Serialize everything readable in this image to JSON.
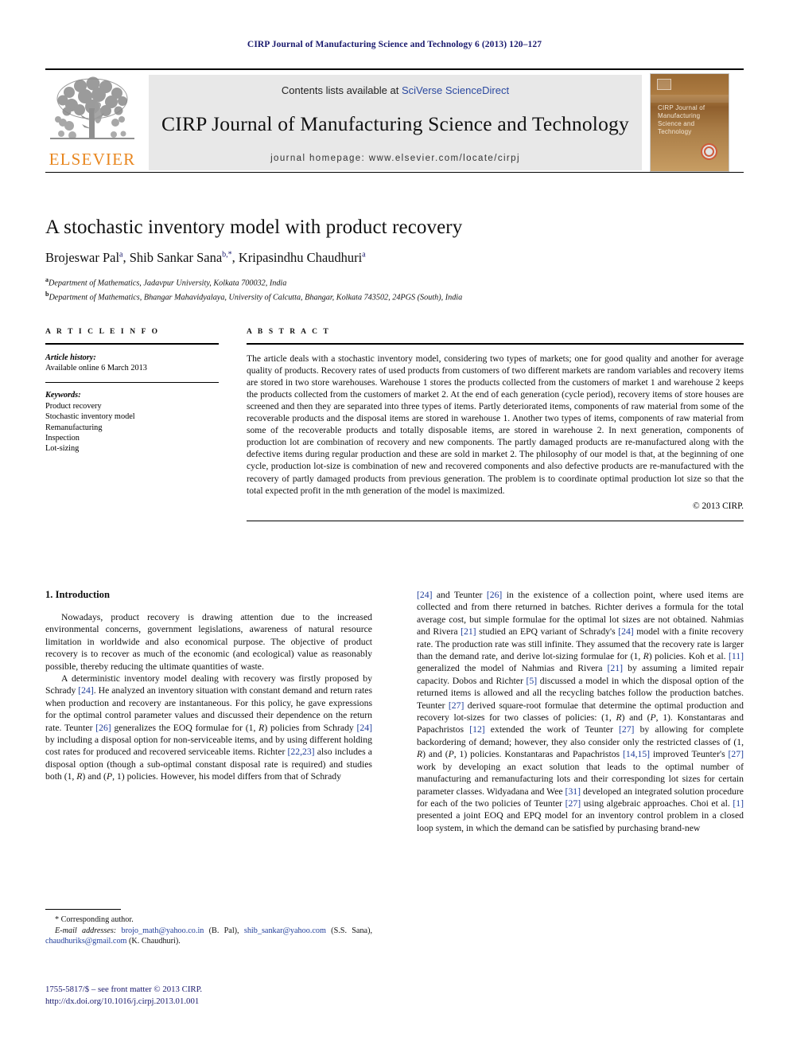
{
  "running_head": "CIRP Journal of Manufacturing Science and Technology 6 (2013) 120–127",
  "masthead": {
    "contents_prefix": "Contents lists available at ",
    "sciencedirect_link": "SciVerse ScienceDirect",
    "journal_title": "CIRP Journal of Manufacturing Science and Technology",
    "homepage_line": "journal homepage: www.elsevier.com/locate/cirpj",
    "publisher_wordmark": "ELSEVIER",
    "publisher_color": "#E8861E",
    "link_color": "#2b49a0",
    "cover": {
      "title_text": "CIRP Journal of Manufacturing Science and Technology",
      "base_color": "#a87b45"
    }
  },
  "article": {
    "title": "A stochastic inventory model with product recovery",
    "authors_html": "Brojeswar Pal<sup>a</sup>, Shib Sankar Sana<sup>b,<span class=\"star\">*</span></sup>, Kripasindhu Chaudhuri<sup>a</sup>",
    "affiliations": [
      {
        "marker": "a",
        "text": "Department of Mathematics, Jadavpur University, Kolkata 700032, India"
      },
      {
        "marker": "b",
        "text": "Department of Mathematics, Bhangar Mahavidyalaya, University of Calcutta, Bhangar, Kolkata 743502, 24PGS (South), India"
      }
    ]
  },
  "article_info": {
    "heading": "A R T I C L E   I N F O",
    "history_label": "Article history:",
    "history_value": "Available online 6 March 2013",
    "keywords_label": "Keywords:",
    "keywords": [
      "Product recovery",
      "Stochastic inventory model",
      "Remanufacturing",
      "Inspection",
      "Lot-sizing"
    ]
  },
  "abstract": {
    "heading": "A B S T R A C T",
    "text": "The article deals with a stochastic inventory model, considering two types of markets; one for good quality and another for average quality of products. Recovery rates of used products from customers of two different markets are random variables and recovery items are stored in two store warehouses. Warehouse 1 stores the products collected from the customers of market 1 and warehouse 2 keeps the products collected from the customers of market 2. At the end of each generation (cycle period), recovery items of store houses are screened and then they are separated into three types of items. Partly deteriorated items, components of raw material from some of the recoverable products and the disposal items are stored in warehouse 1. Another two types of items, components of raw material from some of the recoverable products and totally disposable items, are stored in warehouse 2. In next generation, components of production lot are combination of recovery and new components. The partly damaged products are re-manufactured along with the defective items during regular production and these are sold in market 2. The philosophy of our model is that, at the beginning of one cycle, production lot-size is combination of new and recovered components and also defective products are re-manufactured with the recovery of partly damaged products from previous generation. The problem is to coordinate optimal production lot size so that the total expected profit in the mth generation of the model is maximized.",
    "copyright": "© 2013 CIRP."
  },
  "introduction": {
    "heading": "1.  Introduction",
    "left_paragraphs": [
      "Nowadays, product recovery is drawing attention due to the increased environmental concerns, government legislations, awareness of natural resource limitation in worldwide and also economical purpose. The objective of product recovery is to recover as much of the economic (and ecological) value as reasonably possible, thereby reducing the ultimate quantities of waste.",
      "A deterministic inventory model dealing with recovery was firstly proposed by Schrady <span class=\"ref\">[24]</span>. He analyzed an inventory situation with constant demand and return rates when production and recovery are instantaneous. For this policy, he gave expressions for the optimal control parameter values and discussed their dependence on the return rate. Teunter <span class=\"ref\">[26]</span> generalizes the EOQ formulae for (1, <i>R</i>) policies from Schrady <span class=\"ref\">[24]</span> by including a disposal option for non-serviceable items, and by using different holding cost rates for produced and recovered serviceable items. Richter <span class=\"ref\">[22,23]</span> also includes a disposal option (though a sub-optimal constant disposal rate is required) and studies both (1, <i>R</i>) and (<i>P</i>, 1) policies. However, his model differs from that of Schrady"
    ],
    "right_paragraphs": [
      "<span class=\"ref\">[24]</span> and Teunter <span class=\"ref\">[26]</span> in the existence of a collection point, where used items are collected and from there returned in batches. Richter derives a formula for the total average cost, but simple formulae for the optimal lot sizes are not obtained. Nahmias and Rivera <span class=\"ref\">[21]</span> studied an EPQ variant of Schrady's <span class=\"ref\">[24]</span> model with a finite recovery rate. The production rate was still infinite. They assumed that the recovery rate is larger than the demand rate, and derive lot-sizing formulae for (1, <i>R</i>) policies. Koh et al. <span class=\"ref\">[11]</span> generalized the model of Nahmias and Rivera <span class=\"ref\">[21]</span> by assuming a limited repair capacity. Dobos and Richter <span class=\"ref\">[5]</span> discussed a model in which the disposal option of the returned items is allowed and all the recycling batches follow the production batches. Teunter <span class=\"ref\">[27]</span> derived square-root formulae that determine the optimal production and recovery lot-sizes for two classes of policies: (1, <i>R</i>) and (<i>P</i>, 1). Konstantaras and Papachristos <span class=\"ref\">[12]</span> extended the work of Teunter <span class=\"ref\">[27]</span> by allowing for complete backordering of demand; however, they also consider only the restricted classes of (1, <i>R</i>) and (<i>P</i>, 1) policies. Konstantaras and Papachristos <span class=\"ref\">[14,15]</span> improved Teunter's <span class=\"ref\">[27]</span> work by developing an exact solution that leads to the optimal number of manufacturing and remanufacturing lots and their corresponding lot sizes for certain parameter classes. Widyadana and Wee <span class=\"ref\">[31]</span> developed an integrated solution procedure for each of the two policies of Teunter <span class=\"ref\">[27]</span> using algebraic approaches. Choi et al. <span class=\"ref\">[1]</span> presented a joint EOQ and EPQ model for an inventory control problem in a closed loop system, in which the demand can be satisfied by purchasing brand-new"
    ]
  },
  "footnote": {
    "corresponding": "* Corresponding author.",
    "emails_html": "<span class=\"em-label\">E-mail addresses:</span> <span class=\"mail\">brojo_math@yahoo.co.in</span> (B. Pal), <span class=\"mail\">shib_sankar@yahoo.com</span> (S.S. Sana), <span class=\"mail\">chaudhuriks@gmail.com</span> (K. Chaudhuri)."
  },
  "page_footer": {
    "issn_line": "1755-5817/$ – see front matter © 2013 CIRP.",
    "doi_line": "http://dx.doi.org/10.1016/j.cirpj.2013.01.001"
  }
}
